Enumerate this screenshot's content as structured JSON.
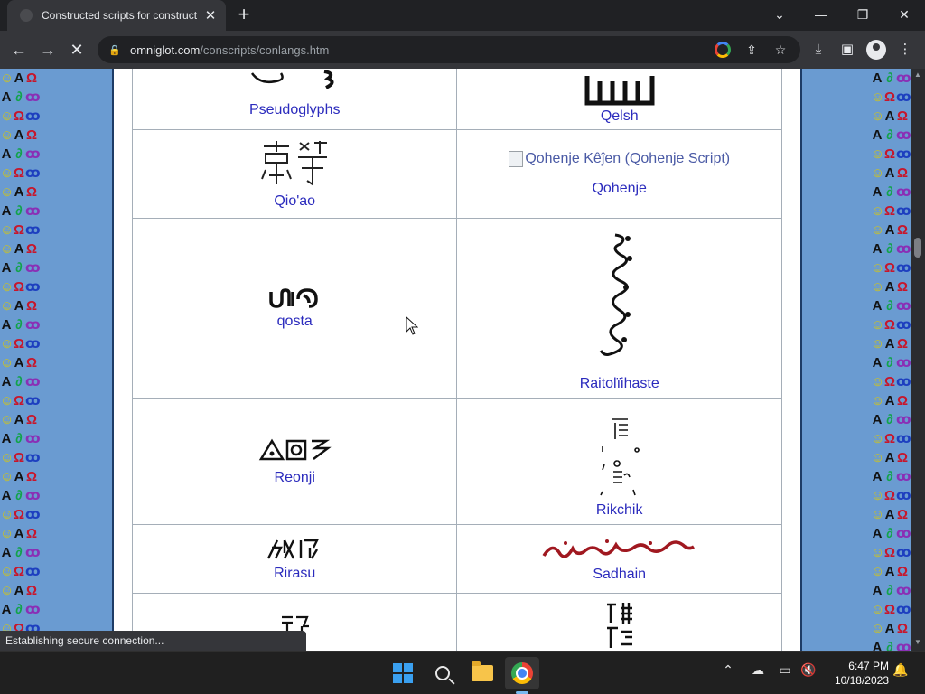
{
  "browser": {
    "tab_title": "Constructed scripts for constructed languages",
    "tab_close": "✕",
    "new_tab": "+",
    "url_host": "omniglot.com",
    "url_path": "/conscripts/conlangs.htm",
    "win_min": "—",
    "win_restore": "❐",
    "win_close": "✕",
    "tab_list": "⌄"
  },
  "page": {
    "rows": [
      {
        "left_label": "Pseudoglyphs",
        "right_label": "Qelsh"
      },
      {
        "left_label": "Qio'ao",
        "right_label": "Qohenje",
        "right_img_alt": "Qohenje Kêĵen (Qohenje Script)"
      },
      {
        "left_label": "qosta",
        "right_label": "Raitolïihaste"
      },
      {
        "left_label": "Reonji",
        "right_label": "Rikchik"
      },
      {
        "left_label": "Rirasu",
        "right_label": "Sadhain"
      }
    ]
  },
  "status_bar": {
    "text": "Establishing secure connection..."
  },
  "taskbar": {
    "time": "6:47 PM",
    "date": "10/18/2023"
  },
  "colors": {
    "link": "#2b2bbd",
    "page_bg": "#6a9bd1",
    "chrome_dark": "#202124"
  }
}
